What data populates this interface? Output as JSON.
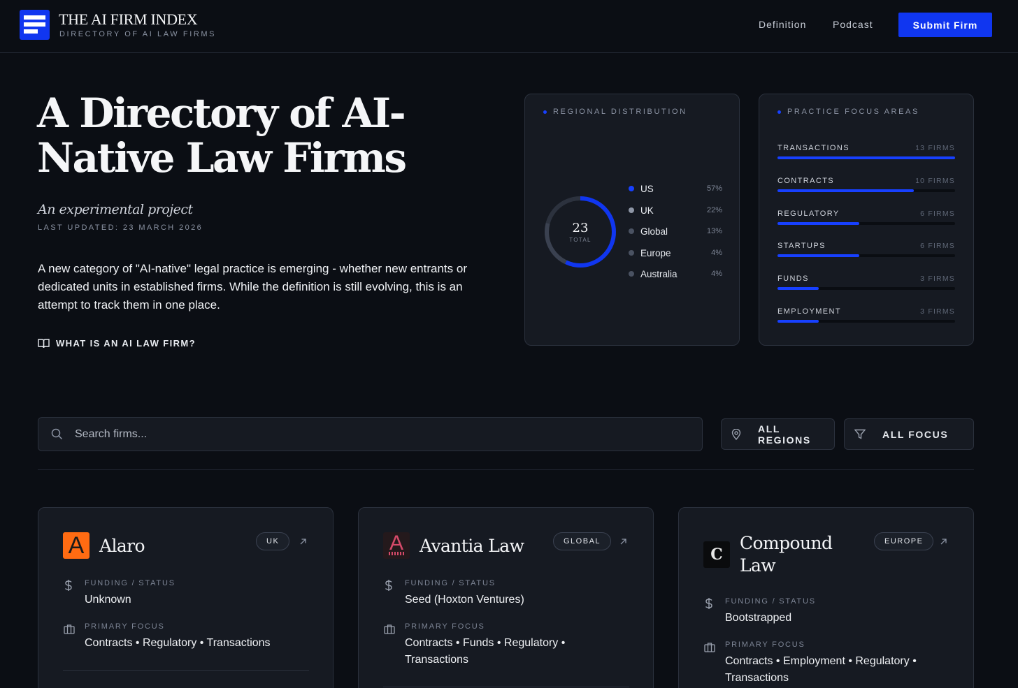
{
  "header": {
    "title": "THE AI FIRM INDEX",
    "subtitle": "DIRECTORY OF AI LAW FIRMS",
    "nav": [
      "Definition",
      "Podcast"
    ],
    "submit_label": "Submit Firm",
    "accent": "#1036f0"
  },
  "hero": {
    "title": "A Directory of AI-Native Law Firms",
    "tagline": "An experimental project",
    "updated": "LAST UPDATED: 23 MARCH 2026",
    "intro": "A new category of \"AI-native\" legal practice is emerging - whether new entrants or dedicated units in established firms. While the definition is still evolving, this is an attempt to track them in one place.",
    "what_link": "WHAT IS AN AI LAW FIRM?",
    "what_icon": "book-open-icon"
  },
  "regional": {
    "label": "REGIONAL DISTRIBUTION",
    "total": "23",
    "total_label": "TOTAL",
    "items": [
      {
        "name": "US",
        "pct": "57%",
        "value": 57,
        "color": "#1740ff"
      },
      {
        "name": "UK",
        "pct": "22%",
        "value": 22,
        "color": "#8e96a6"
      },
      {
        "name": "Global",
        "pct": "13%",
        "value": 13,
        "color": "#4a5262"
      },
      {
        "name": "Europe",
        "pct": "4%",
        "value": 4,
        "color": "#4a5262"
      },
      {
        "name": "Australia",
        "pct": "4%",
        "value": 4,
        "color": "#4a5262"
      }
    ]
  },
  "focus": {
    "label": "PRACTICE FOCUS AREAS",
    "items": [
      {
        "name": "TRANSACTIONS",
        "count": "13 FIRMS",
        "value": 13
      },
      {
        "name": "CONTRACTS",
        "count": "10 FIRMS",
        "value": 10
      },
      {
        "name": "REGULATORY",
        "count": "6 FIRMS",
        "value": 6
      },
      {
        "name": "STARTUPS",
        "count": "6 FIRMS",
        "value": 6
      },
      {
        "name": "FUNDS",
        "count": "3 FIRMS",
        "value": 3
      },
      {
        "name": "EMPLOYMENT",
        "count": "3 FIRMS",
        "value": 3
      }
    ],
    "max": 13
  },
  "filters": {
    "search_placeholder": "Search firms...",
    "regions_label": "ALL REGIONS",
    "focus_label": "ALL FOCUS"
  },
  "cards": [
    {
      "name": "Alaro",
      "logo_letter": "A",
      "region": "UK",
      "funding_label": "FUNDING / STATUS",
      "funding": "Unknown",
      "focus_label": "PRIMARY FOCUS",
      "focus": "Contracts • Regulatory • Transactions"
    },
    {
      "name": "Avantia Law",
      "logo_letter": "A",
      "region": "GLOBAL",
      "funding_label": "FUNDING / STATUS",
      "funding": "Seed (Hoxton Ventures)",
      "focus_label": "PRIMARY FOCUS",
      "focus": "Contracts • Funds • Regulatory • Transactions"
    },
    {
      "name": "Compound Law",
      "logo_letter": "C",
      "region": "EUROPE",
      "funding_label": "FUNDING / STATUS",
      "funding": "Bootstrapped",
      "focus_label": "PRIMARY FOCUS",
      "focus": "Contracts • Employment • Regulatory • Transactions"
    }
  ]
}
